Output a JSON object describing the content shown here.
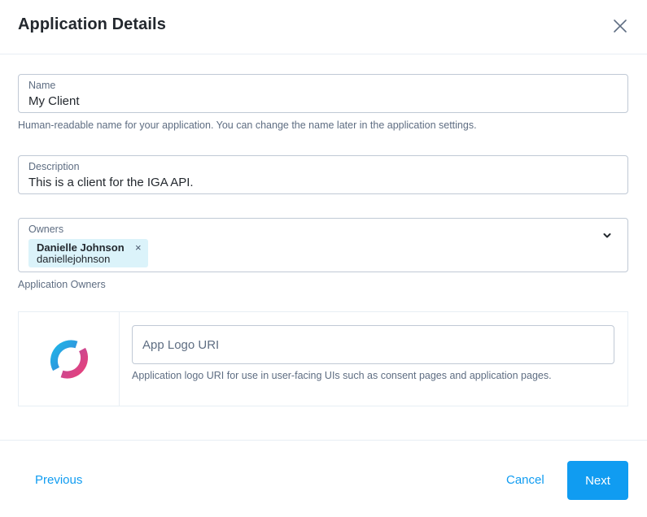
{
  "dialog": {
    "title": "Application Details"
  },
  "fields": {
    "name": {
      "label": "Name",
      "value": "My Client",
      "help": "Human-readable name for your application. You can change the name later in the application settings."
    },
    "description": {
      "label": "Description",
      "value": "This is a client for the IGA API."
    },
    "owners": {
      "label": "Owners",
      "chip": {
        "name": "Danielle Johnson",
        "username": "daniellejohnson",
        "remove_icon": "×"
      },
      "help": "Application Owners"
    }
  },
  "logo": {
    "input_placeholder": "App Logo URI",
    "help": "Application logo URI for use in user-facing UIs such as consent pages and application pages.",
    "colors": [
      "#1fb6e8",
      "#e8407a"
    ]
  },
  "footer": {
    "previous_label": "Previous",
    "cancel_label": "Cancel",
    "next_label": "Next"
  },
  "colors": {
    "accent": "#109cf1",
    "chip_bg": "#dbf3fa"
  }
}
